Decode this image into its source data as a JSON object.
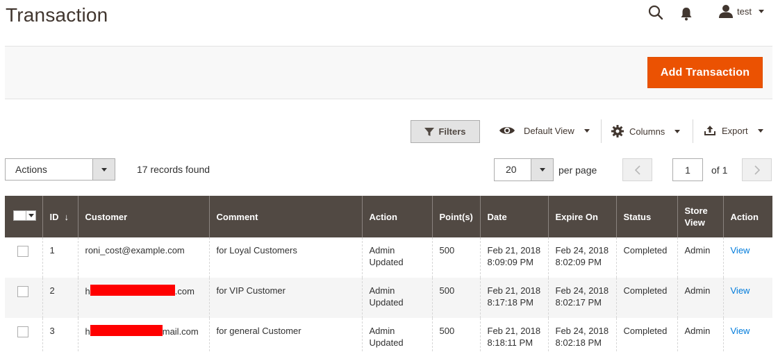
{
  "page": {
    "title": "Transaction"
  },
  "header": {
    "user_name": "test"
  },
  "action_bar": {
    "add_button": "Add Transaction"
  },
  "toolbar": {
    "filters_label": "Filters",
    "view_label": "Default View",
    "columns_label": "Columns",
    "export_label": "Export",
    "actions_value": "Actions",
    "records_text": "17 records found",
    "per_page_value": "20",
    "per_page_label": "per page",
    "current_page": "1",
    "page_of": "of 1"
  },
  "grid": {
    "columns": [
      "ID",
      "Customer",
      "Comment",
      "Action",
      "Point(s)",
      "Date",
      "Expire On",
      "Status",
      "Store View",
      "Action"
    ],
    "sort_indicator": "↓",
    "rows": [
      {
        "id": "1",
        "customer_prefix": "roni_cost@example.com",
        "customer_suffix": "",
        "comment": "for Loyal Customers",
        "action_line1": "Admin",
        "action_line2": "Updated",
        "points": "500",
        "date_line1": "Feb 21, 2018",
        "date_line2": "8:09:09 PM",
        "expire_line1": "Feb 24, 2018",
        "expire_line2": "8:02:09 PM",
        "status": "Completed",
        "store_view": "Admin",
        "view_link": "View"
      },
      {
        "id": "2",
        "customer_prefix": "h",
        "customer_suffix": ".com",
        "comment": "for VIP Customer",
        "action_line1": "Admin",
        "action_line2": "Updated",
        "points": "500",
        "date_line1": "Feb 21, 2018",
        "date_line2": "8:17:18 PM",
        "expire_line1": "Feb 24, 2018",
        "expire_line2": "8:02:17 PM",
        "status": "Completed",
        "store_view": "Admin",
        "view_link": "View"
      },
      {
        "id": "3",
        "customer_prefix": "h",
        "customer_suffix": "mail.com",
        "comment": "for general Customer",
        "action_line1": "Admin",
        "action_line2": "Updated",
        "points": "500",
        "date_line1": "Feb 21, 2018",
        "date_line2": "8:18:11 PM",
        "expire_line1": "Feb 24, 2018",
        "expire_line2": "8:02:18 PM",
        "status": "Completed",
        "store_view": "Admin",
        "view_link": "View"
      }
    ]
  },
  "icons": {
    "search": "search-icon",
    "notifications": "bell-icon",
    "user": "user-icon",
    "filter": "funnel-icon",
    "view": "eye-icon",
    "columns": "gear-icon",
    "export": "export-icon"
  },
  "colors": {
    "primary_button": "#eb5202",
    "grid_header": "#514943",
    "link": "#007bdb",
    "redaction": "#ff0000"
  }
}
